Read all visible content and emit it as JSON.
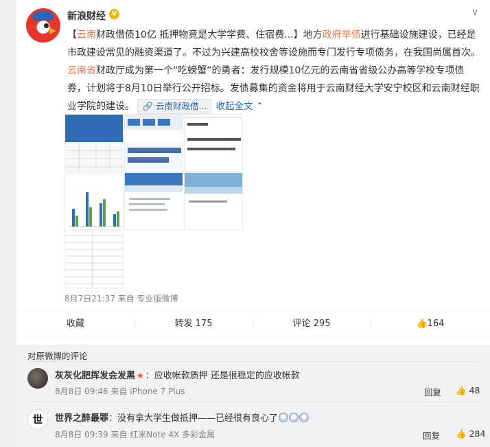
{
  "post": {
    "author": "新浪财经",
    "verified_badge": "V",
    "more_icon": "chevron-down-icon",
    "text_part1": "【",
    "hl1": "云南",
    "text_part2": "财政借债10亿 抵押物竟是大学学费、住宿费...】地方",
    "hl2": "政府举债",
    "text_part3": "进行基础设施建设，已经是市政建设常见的融资渠道了。不过为兴建高校校舍等设施而专门发行专项债务，在我国尚属首次。",
    "hl3": "云南省",
    "text_part4": "财政厅成为第一个“吃螃蟹”的勇者：发行规模10亿元的云南省省级公办高等学校专项债券，计划将于8月10日举行公开招标。发债募集的资金将用于云南财经大学安宁校区和云南财经职业学院的建设。",
    "link_chip_label": "云南财政借...",
    "collapse_label": "收起全文",
    "time_source": "8月7日21:37 来自 专业版微博"
  },
  "actions": {
    "collect": "收藏",
    "repost": "转发 175",
    "comment": "评论 295",
    "like": "164"
  },
  "comments": {
    "title": "对原微博的评论",
    "items": [
      {
        "name": "灰灰化肥挥发会发黑",
        "text": "：应收帐款质押 还是很稳定的应收帐款",
        "meta": "8月8日 09:46 来自 iPhone 7 Plus",
        "reply": "回复",
        "likes": "48"
      },
      {
        "name": "世界之醉最罪",
        "text": "：没有拿大学生做抵押——已经很有良心了",
        "meta": "8月8日 09:39 来自 红米Note 4X 多彩金属",
        "reply": "回复",
        "likes": "284",
        "avatar_text": "世"
      }
    ]
  },
  "colors": {
    "highlight": "#eb7350",
    "link": "#1e6bb8",
    "meta": "#808080"
  }
}
